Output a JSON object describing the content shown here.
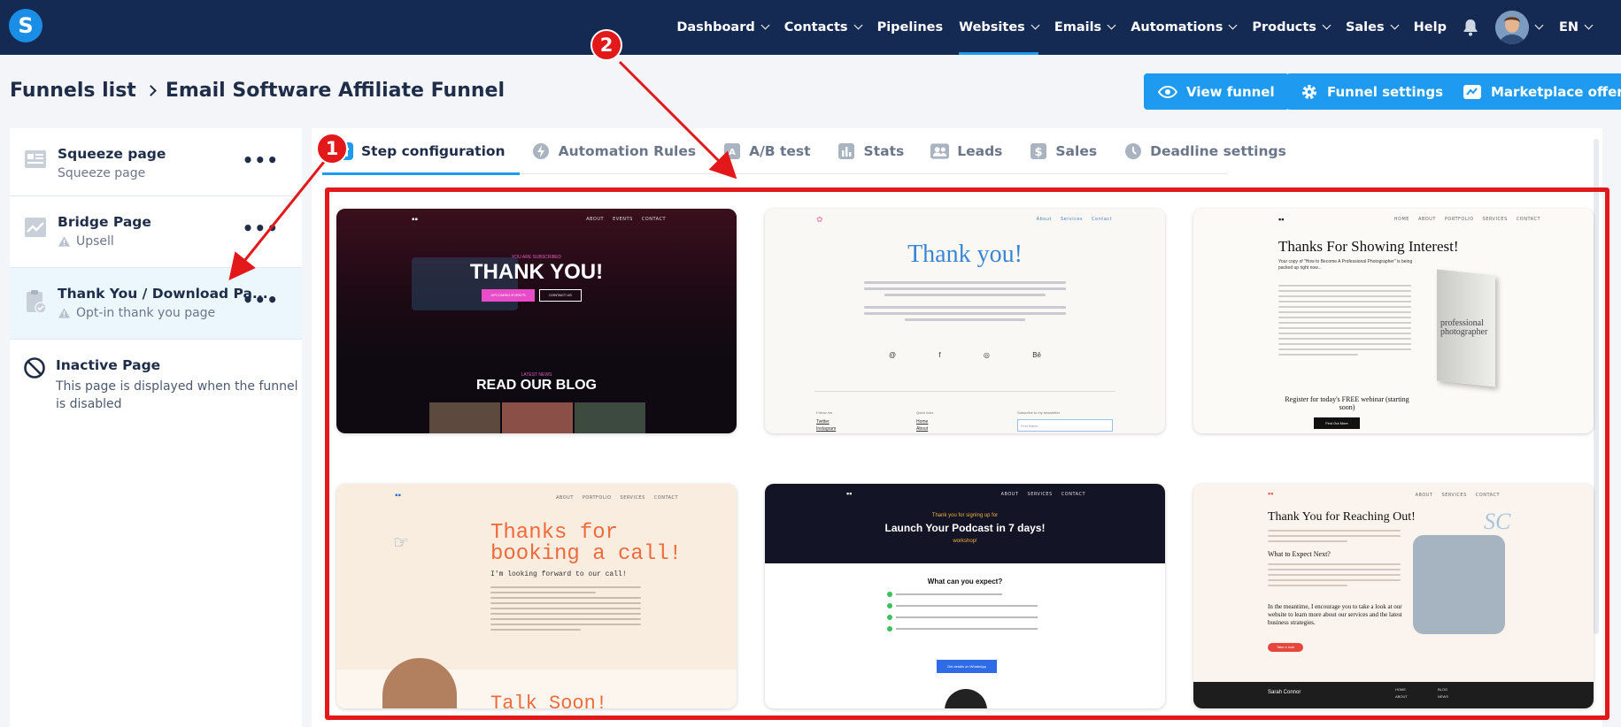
{
  "app": {
    "logo_letter": "S",
    "nav": [
      {
        "label": "Dashboard",
        "caret": true
      },
      {
        "label": "Contacts",
        "caret": true
      },
      {
        "label": "Pipelines",
        "caret": false
      },
      {
        "label": "Websites",
        "caret": true,
        "active": true
      },
      {
        "label": "Emails",
        "caret": true
      },
      {
        "label": "Automations",
        "caret": true
      },
      {
        "label": "Products",
        "caret": true
      },
      {
        "label": "Sales",
        "caret": true
      },
      {
        "label": "Help",
        "caret": false
      }
    ],
    "language": "EN",
    "accent": "#1e9bf0",
    "nav_bg": "#152a53"
  },
  "header": {
    "breadcrumb_root": "Funnels list",
    "breadcrumb_current": "Email Software Affiliate Funnel",
    "view_funnel": "View funnel",
    "funnel_settings": "Funnel settings",
    "marketplace_offer": "Marketplace offer"
  },
  "sidebar": {
    "steps": [
      {
        "title": "Squeeze page",
        "subtitle": "Squeeze page",
        "icon": "squeeze-page-icon",
        "warning": false
      },
      {
        "title": "Bridge Page",
        "subtitle": "Upsell",
        "icon": "chart-icon",
        "warning": true
      },
      {
        "title": "Thank You / Download Pa...",
        "subtitle": "Opt-in thank you page",
        "icon": "clipboard-check-icon",
        "warning": true
      }
    ],
    "inactive": {
      "title": "Inactive Page",
      "description": "This page is displayed when the funnel is disabled"
    }
  },
  "tabs": [
    {
      "label": "Step configuration",
      "icon": "sliders-icon",
      "active": true
    },
    {
      "label": "Automation Rules",
      "icon": "bolt-icon"
    },
    {
      "label": "A/B test",
      "icon": "ab-test-icon"
    },
    {
      "label": "Stats",
      "icon": "bar-chart-icon"
    },
    {
      "label": "Leads",
      "icon": "users-icon"
    },
    {
      "label": "Sales",
      "icon": "dollar-icon"
    },
    {
      "label": "Deadline settings",
      "icon": "clock-icon"
    }
  ],
  "templates": [
    {
      "name": "template-dark-concert",
      "nav": [
        "ABOUT",
        "EVENTS",
        "CONTACT"
      ],
      "kicker": "YOU ARE SUBSCRIBED",
      "headline": "THANK YOU!",
      "btn1": "UPCOMING EVENTS",
      "btn2": "CONTACT US",
      "kicker2": "LATEST NEWS",
      "headline2": "READ OUR BLOG"
    },
    {
      "name": "template-thank-you-designer",
      "nav": [
        "About",
        "Services",
        "Contact"
      ],
      "headline": "Thank you!",
      "social": [
        "@",
        "f",
        "◎",
        "Bē"
      ],
      "footer_cols": [
        "Follow me",
        "Quick links",
        "Subscribe to my newsletter"
      ],
      "footer_links": [
        "Twitter",
        "Instagram",
        "Home",
        "About"
      ],
      "input_placeholder": "First Name"
    },
    {
      "name": "template-photographer-interest",
      "nav": [
        "HOME",
        "ABOUT",
        "PORTFOLIO",
        "SERVICES",
        "CONTACT"
      ],
      "headline": "Thanks For Showing Interest!",
      "sub": "Your copy of \"How to Become A Professional Photographer\" is being packed up right now...",
      "book_title": "professional photographer",
      "webinar": "Register for today's FREE webinar (starting soon)",
      "btn": "Find Out More"
    },
    {
      "name": "template-booking-call",
      "nav": [
        "ABOUT",
        "PORTFOLIO",
        "SERVICES",
        "CONTACT"
      ],
      "headline": "Thanks for booking a call!",
      "sub": "I'm looking forward to our call!",
      "bottom": "Talk Soon!"
    },
    {
      "name": "template-podcast-signup",
      "nav": [
        "ABOUT",
        "SERVICES",
        "CONTACT"
      ],
      "kicker": "Thank you for signing up for",
      "headline": "Launch Your Podcast in 7 days!",
      "kicker2": "workshop!",
      "section": "What can you expect?",
      "btn": "Get details on WhatsApp"
    },
    {
      "name": "template-reaching-out",
      "nav": [
        "ABOUT",
        "SERVICES",
        "CONTACT"
      ],
      "headline": "Thank You for Reaching Out!",
      "section": "What to Expect Next?",
      "para": "In the meantime, I encourage you to take a look at our website to learn more about our services and the latest business strategies.",
      "btn": "Take a look",
      "footer_name": "Sarah Connor",
      "footer_links": [
        "HOME",
        "BLOG",
        "ABOUT",
        "NEWS"
      ],
      "monogram": "SC"
    }
  ],
  "annotations": {
    "badge1": "1",
    "badge2": "2",
    "color": "#e3181b"
  }
}
